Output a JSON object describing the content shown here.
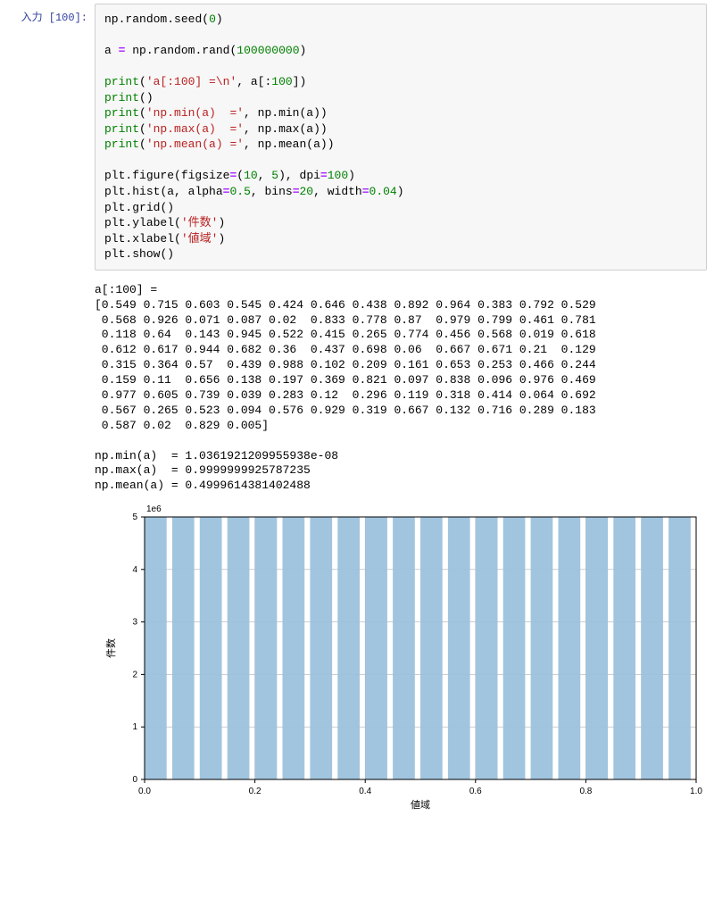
{
  "prompt_label": "入力 [100]:",
  "code_tokens": [
    {
      "t": "np",
      "c": ""
    },
    {
      "t": ".",
      "c": ""
    },
    {
      "t": "random",
      "c": ""
    },
    {
      "t": ".",
      "c": ""
    },
    {
      "t": "seed",
      "c": ""
    },
    {
      "t": "(",
      "c": ""
    },
    {
      "t": "0",
      "c": "tok-num"
    },
    {
      "t": ")",
      "c": ""
    },
    {
      "t": "\n\n",
      "c": ""
    },
    {
      "t": "a ",
      "c": ""
    },
    {
      "t": "=",
      "c": "tok-op"
    },
    {
      "t": " np",
      "c": ""
    },
    {
      "t": ".",
      "c": ""
    },
    {
      "t": "random",
      "c": ""
    },
    {
      "t": ".",
      "c": ""
    },
    {
      "t": "rand",
      "c": ""
    },
    {
      "t": "(",
      "c": ""
    },
    {
      "t": "100000000",
      "c": "tok-num"
    },
    {
      "t": ")",
      "c": ""
    },
    {
      "t": "\n\n",
      "c": ""
    },
    {
      "t": "print",
      "c": "tok-builtin"
    },
    {
      "t": "(",
      "c": ""
    },
    {
      "t": "'a[:100] =\\n'",
      "c": "tok-str"
    },
    {
      "t": ", a[:",
      "c": ""
    },
    {
      "t": "100",
      "c": "tok-num"
    },
    {
      "t": "])",
      "c": ""
    },
    {
      "t": "\n",
      "c": ""
    },
    {
      "t": "print",
      "c": "tok-builtin"
    },
    {
      "t": "()",
      "c": ""
    },
    {
      "t": "\n",
      "c": ""
    },
    {
      "t": "print",
      "c": "tok-builtin"
    },
    {
      "t": "(",
      "c": ""
    },
    {
      "t": "'np.min(a)  ='",
      "c": "tok-str"
    },
    {
      "t": ", np",
      "c": ""
    },
    {
      "t": ".",
      "c": ""
    },
    {
      "t": "min",
      "c": ""
    },
    {
      "t": "(a))",
      "c": ""
    },
    {
      "t": "\n",
      "c": ""
    },
    {
      "t": "print",
      "c": "tok-builtin"
    },
    {
      "t": "(",
      "c": ""
    },
    {
      "t": "'np.max(a)  ='",
      "c": "tok-str"
    },
    {
      "t": ", np",
      "c": ""
    },
    {
      "t": ".",
      "c": ""
    },
    {
      "t": "max",
      "c": ""
    },
    {
      "t": "(a))",
      "c": ""
    },
    {
      "t": "\n",
      "c": ""
    },
    {
      "t": "print",
      "c": "tok-builtin"
    },
    {
      "t": "(",
      "c": ""
    },
    {
      "t": "'np.mean(a) ='",
      "c": "tok-str"
    },
    {
      "t": ", np",
      "c": ""
    },
    {
      "t": ".",
      "c": ""
    },
    {
      "t": "mean",
      "c": ""
    },
    {
      "t": "(a))",
      "c": ""
    },
    {
      "t": "\n\n",
      "c": ""
    },
    {
      "t": "plt",
      "c": ""
    },
    {
      "t": ".",
      "c": ""
    },
    {
      "t": "figure",
      "c": ""
    },
    {
      "t": "(figsize",
      "c": ""
    },
    {
      "t": "=",
      "c": "tok-op"
    },
    {
      "t": "(",
      "c": ""
    },
    {
      "t": "10",
      "c": "tok-num"
    },
    {
      "t": ", ",
      "c": ""
    },
    {
      "t": "5",
      "c": "tok-num"
    },
    {
      "t": "), dpi",
      "c": ""
    },
    {
      "t": "=",
      "c": "tok-op"
    },
    {
      "t": "100",
      "c": "tok-num"
    },
    {
      "t": ")",
      "c": ""
    },
    {
      "t": "\n",
      "c": ""
    },
    {
      "t": "plt",
      "c": ""
    },
    {
      "t": ".",
      "c": ""
    },
    {
      "t": "hist",
      "c": ""
    },
    {
      "t": "(a, alpha",
      "c": ""
    },
    {
      "t": "=",
      "c": "tok-op"
    },
    {
      "t": "0.5",
      "c": "tok-num"
    },
    {
      "t": ", bins",
      "c": ""
    },
    {
      "t": "=",
      "c": "tok-op"
    },
    {
      "t": "20",
      "c": "tok-num"
    },
    {
      "t": ", width",
      "c": ""
    },
    {
      "t": "=",
      "c": "tok-op"
    },
    {
      "t": "0.04",
      "c": "tok-num"
    },
    {
      "t": ")",
      "c": ""
    },
    {
      "t": "\n",
      "c": ""
    },
    {
      "t": "plt",
      "c": ""
    },
    {
      "t": ".",
      "c": ""
    },
    {
      "t": "grid",
      "c": ""
    },
    {
      "t": "()",
      "c": ""
    },
    {
      "t": "\n",
      "c": ""
    },
    {
      "t": "plt",
      "c": ""
    },
    {
      "t": ".",
      "c": ""
    },
    {
      "t": "ylabel",
      "c": ""
    },
    {
      "t": "(",
      "c": ""
    },
    {
      "t": "'件数'",
      "c": "tok-str"
    },
    {
      "t": ")",
      "c": ""
    },
    {
      "t": "\n",
      "c": ""
    },
    {
      "t": "plt",
      "c": ""
    },
    {
      "t": ".",
      "c": ""
    },
    {
      "t": "xlabel",
      "c": ""
    },
    {
      "t": "(",
      "c": ""
    },
    {
      "t": "'値域'",
      "c": "tok-str"
    },
    {
      "t": ")",
      "c": ""
    },
    {
      "t": "\n",
      "c": ""
    },
    {
      "t": "plt",
      "c": ""
    },
    {
      "t": ".",
      "c": ""
    },
    {
      "t": "show",
      "c": ""
    },
    {
      "t": "()",
      "c": ""
    }
  ],
  "output_text": "a[:100] =\n[0.549 0.715 0.603 0.545 0.424 0.646 0.438 0.892 0.964 0.383 0.792 0.529\n 0.568 0.926 0.071 0.087 0.02  0.833 0.778 0.87  0.979 0.799 0.461 0.781\n 0.118 0.64  0.143 0.945 0.522 0.415 0.265 0.774 0.456 0.568 0.019 0.618\n 0.612 0.617 0.944 0.682 0.36  0.437 0.698 0.06  0.667 0.671 0.21  0.129\n 0.315 0.364 0.57  0.439 0.988 0.102 0.209 0.161 0.653 0.253 0.466 0.244\n 0.159 0.11  0.656 0.138 0.197 0.369 0.821 0.097 0.838 0.096 0.976 0.469\n 0.977 0.605 0.739 0.039 0.283 0.12  0.296 0.119 0.318 0.414 0.064 0.692\n 0.567 0.265 0.523 0.094 0.576 0.929 0.319 0.667 0.132 0.716 0.289 0.183\n 0.587 0.02  0.829 0.005]\n\nnp.min(a)  = 1.0361921209955938e-08\nnp.max(a)  = 0.9999999925787235\nnp.mean(a) = 0.4999614381402488",
  "chart_data": {
    "type": "bar",
    "title": "",
    "xlabel": "値域",
    "ylabel": "件数",
    "y_scale_label": "1e6",
    "xlim": [
      0.0,
      1.0
    ],
    "ylim": [
      0,
      5000000
    ],
    "x_ticks": [
      0.0,
      0.2,
      0.4,
      0.6,
      0.8,
      1.0
    ],
    "y_ticks": [
      0,
      1,
      2,
      3,
      4,
      5
    ],
    "bin_edges": [
      0.0,
      0.05,
      0.1,
      0.15,
      0.2,
      0.25,
      0.3,
      0.35,
      0.4,
      0.45,
      0.5,
      0.55,
      0.6,
      0.65,
      0.7,
      0.75,
      0.8,
      0.85,
      0.9,
      0.95,
      1.0
    ],
    "values": [
      5000000,
      5000000,
      5000000,
      5000000,
      5000000,
      5000000,
      5000000,
      5000000,
      5000000,
      5000000,
      5000000,
      5000000,
      5000000,
      5000000,
      5000000,
      5000000,
      5000000,
      5000000,
      5000000,
      5000000
    ],
    "bar_width_data": 0.04,
    "grid": true
  }
}
